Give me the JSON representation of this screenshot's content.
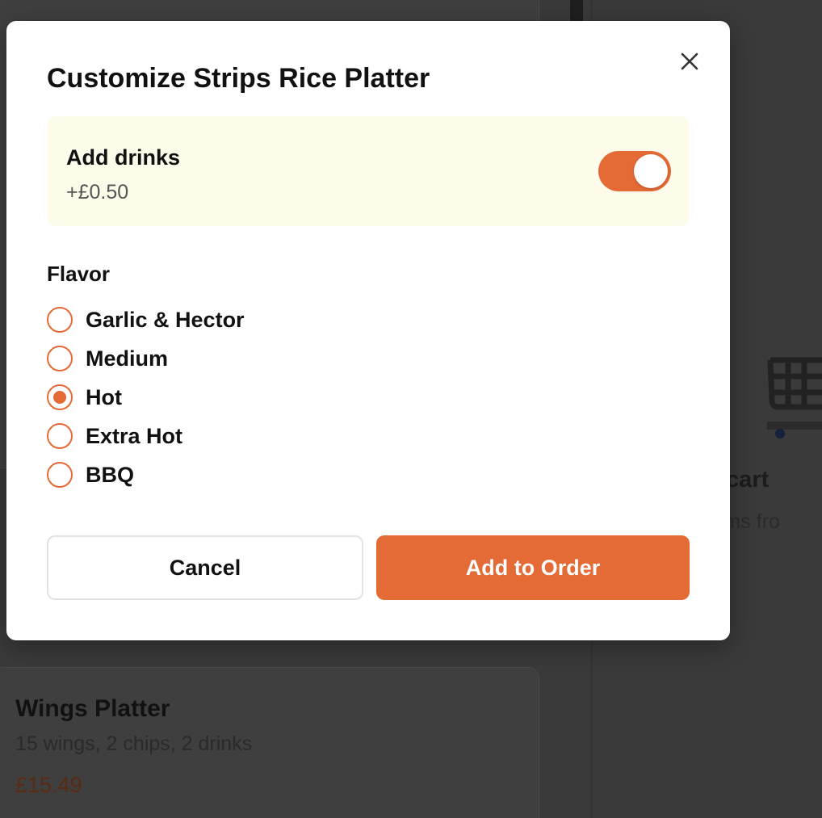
{
  "modal": {
    "title": "Customize Strips Rice Platter",
    "drinks": {
      "label": "Add drinks",
      "price": "+£0.50",
      "enabled": true
    },
    "flavor": {
      "label": "Flavor",
      "options": [
        "Garlic & Hector",
        "Medium",
        "Hot",
        "Extra Hot",
        "BBQ"
      ],
      "selected": "Hot"
    },
    "cancel_label": "Cancel",
    "add_label": "Add to Order"
  },
  "background": {
    "item": {
      "name": "Wings Platter",
      "description": "15 wings, 2 chips, 2 drinks",
      "price": "£15.49"
    },
    "cart": {
      "title": "ur cart",
      "subtitle": "items fro"
    }
  },
  "colors": {
    "accent": "#e46a36",
    "drinks_bg": "#fdfbea",
    "overlay": "#3a3a3a"
  },
  "icons": {
    "close": "close-icon",
    "cart": "cart-icon"
  }
}
